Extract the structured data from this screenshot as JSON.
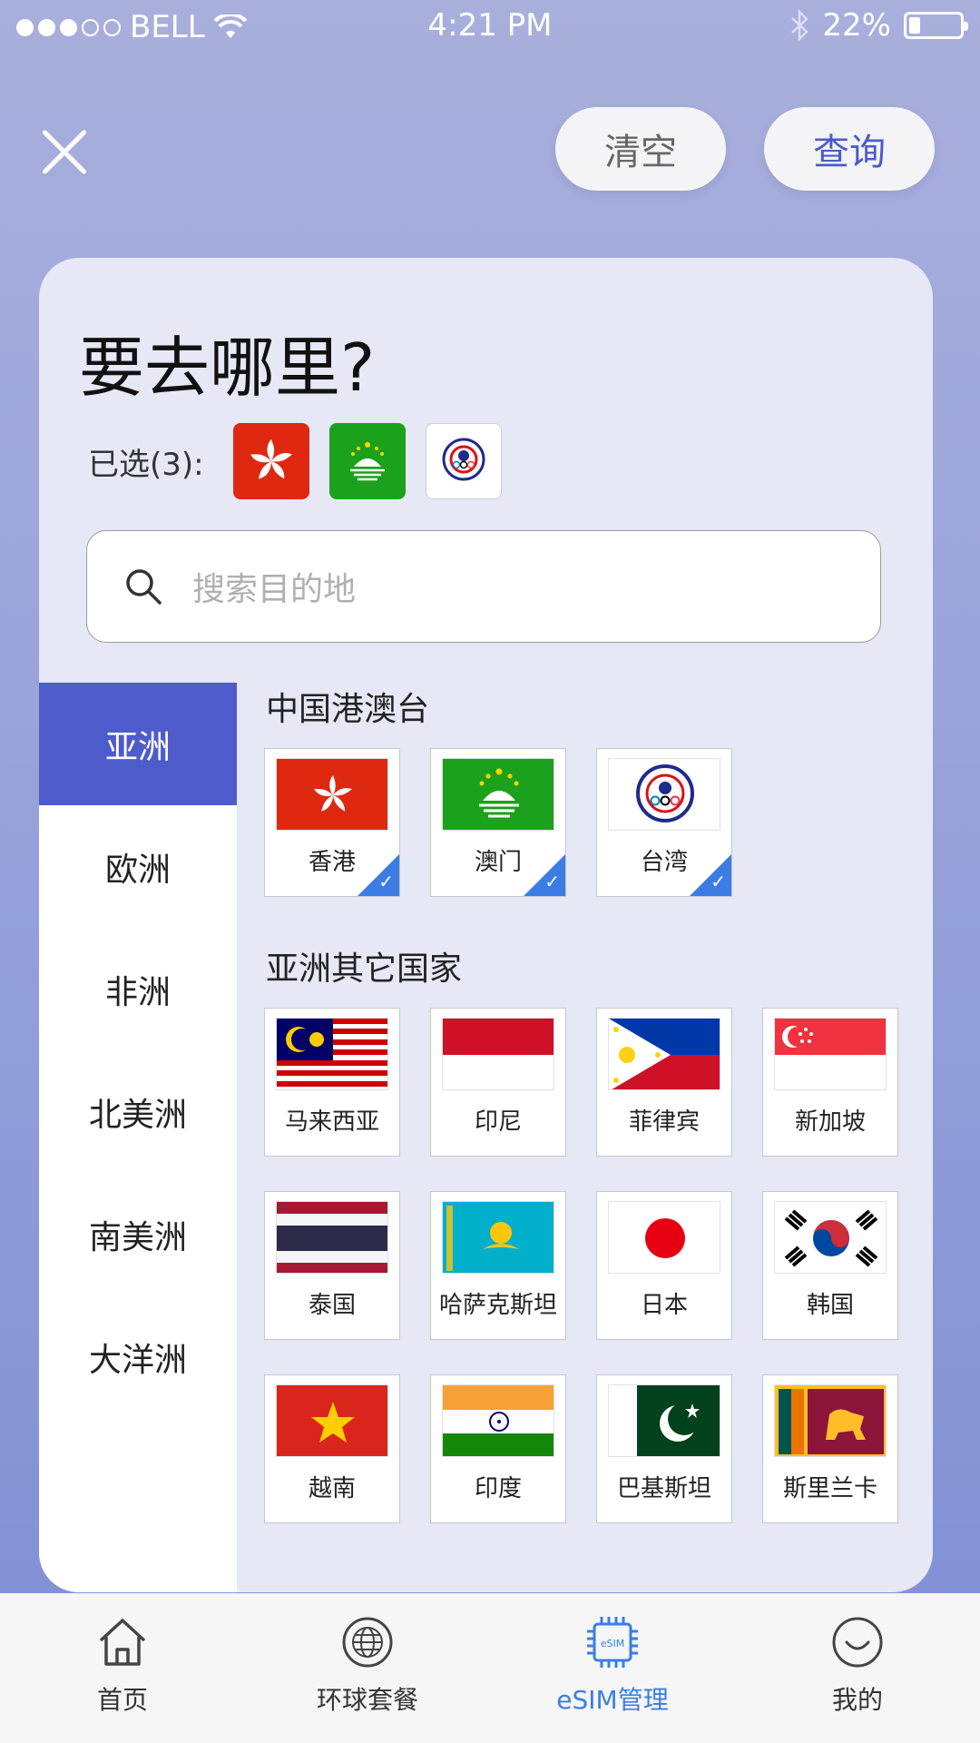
{
  "status_bar": {
    "carrier": "BELL",
    "time": "4:21 PM",
    "battery": "22%",
    "battery_level": 0.22
  },
  "header": {
    "clear_label": "清空",
    "query_label": "查询"
  },
  "title": "要去哪里?",
  "selected": {
    "label": "已选(3):",
    "flags": [
      "hong-kong-flag-icon",
      "macau-flag-icon",
      "taiwan-flag-icon"
    ]
  },
  "search": {
    "placeholder": "搜索目的地"
  },
  "sidebar": {
    "items": [
      {
        "label": "亚洲",
        "active": true
      },
      {
        "label": "欧洲"
      },
      {
        "label": "非洲"
      },
      {
        "label": "北美洲"
      },
      {
        "label": "南美洲"
      },
      {
        "label": "大洋洲"
      }
    ]
  },
  "sections": [
    {
      "title": "中国港澳台",
      "items": [
        {
          "name": "香港",
          "checked": true,
          "icon": "hong-kong-flag-icon"
        },
        {
          "name": "澳门",
          "checked": true,
          "icon": "macau-flag-icon"
        },
        {
          "name": "台湾",
          "checked": true,
          "icon": "taiwan-flag-icon"
        }
      ]
    },
    {
      "title": "亚洲其它国家",
      "items": [
        {
          "name": "马来西亚",
          "icon": "malaysia-flag-icon"
        },
        {
          "name": "印尼",
          "icon": "indonesia-flag-icon"
        },
        {
          "name": "菲律宾",
          "icon": "philippines-flag-icon"
        },
        {
          "name": "新加坡",
          "icon": "singapore-flag-icon"
        },
        {
          "name": "泰国",
          "icon": "thailand-flag-icon"
        },
        {
          "name": "哈萨克斯坦",
          "icon": "kazakhstan-flag-icon"
        },
        {
          "name": "日本",
          "icon": "japan-flag-icon"
        },
        {
          "name": "韩国",
          "icon": "korea-flag-icon"
        },
        {
          "name": "越南",
          "icon": "vietnam-flag-icon"
        },
        {
          "name": "印度",
          "icon": "india-flag-icon"
        },
        {
          "name": "巴基斯坦",
          "icon": "pakistan-flag-icon"
        },
        {
          "name": "斯里兰卡",
          "icon": "sri-lanka-flag-icon"
        }
      ]
    }
  ],
  "tabbar": {
    "items": [
      {
        "label": "首页",
        "icon": "home-icon"
      },
      {
        "label": "环球套餐",
        "icon": "globe-icon"
      },
      {
        "label": "eSIM管理",
        "icon": "esim-chip-icon",
        "active": true
      },
      {
        "label": "我的",
        "icon": "smiley-profile-icon"
      }
    ]
  },
  "colors": {
    "accent": "#4d5bcb",
    "tab_active": "#3b7de4",
    "check": "#3b7de4"
  }
}
